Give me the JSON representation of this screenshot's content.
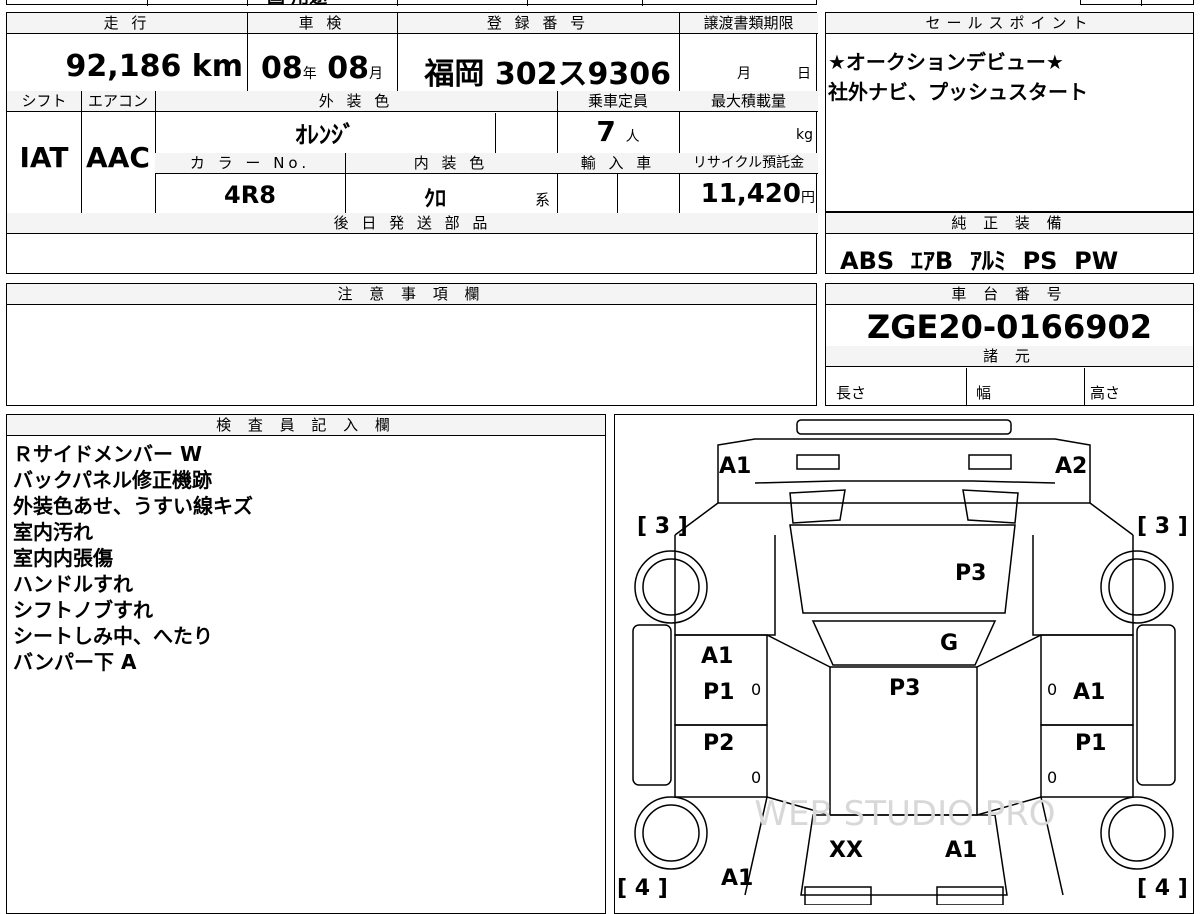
{
  "top_fragments": {
    "left": "国  用途",
    "mid": "♪"
  },
  "mileage": {
    "label": "走 行",
    "value": "92,186",
    "unit": "km"
  },
  "shaken": {
    "label": "車 検",
    "year": "08",
    "year_unit": "年",
    "month": "08",
    "month_unit": "月"
  },
  "plate": {
    "label": "登 録 番 号",
    "area": "福岡",
    "number": "302",
    "kana": "ス",
    "serial": "9306"
  },
  "transfer_deadline": {
    "label": "譲渡書類期限",
    "month_unit": "月",
    "day_unit": "日"
  },
  "shift": {
    "label": "シフト",
    "value": "IAT"
  },
  "aircon": {
    "label": "エアコン",
    "value": "AAC"
  },
  "exterior_color": {
    "label": "外 装 色",
    "value": "ｵﾚﾝｼﾞ"
  },
  "capacity": {
    "label": "乗車定員",
    "value": "7",
    "unit": "人"
  },
  "max_load": {
    "label": "最大積載量",
    "unit": "kg"
  },
  "color_no": {
    "label": "カ ラ ー No.",
    "value": "4R8"
  },
  "interior_color": {
    "label": "内 装 色",
    "value": "ｸﾛ",
    "suffix": "系"
  },
  "import": {
    "label": "輸 入 車"
  },
  "recycle": {
    "label": "リサイクル預託金",
    "value": "11,420",
    "unit": "円"
  },
  "later_parts": {
    "label": "後 日 発 送 部 品"
  },
  "sales_points": {
    "label": "セールスポイント",
    "lines": [
      "★オークションデビュー★",
      "社外ナビ、プッシュスタート"
    ]
  },
  "genuine_equipment": {
    "label": "純 正 装 備",
    "value": "ABS  ｴｱB  ｱﾙﾐ  PS  PW"
  },
  "notes": {
    "label": "注 意 事 項 欄"
  },
  "chassis": {
    "label": "車 台 番 号",
    "value": "ZGE20-0166902"
  },
  "specs": {
    "label": "諸 元",
    "length": "長さ",
    "width": "幅",
    "height": "高さ"
  },
  "inspector": {
    "label": "検 査 員 記 入 欄",
    "lines": [
      "Ｒサイドメンバー W",
      "バックパネル修正機跡",
      "外装色あせ、うすい線キズ",
      "室内汚れ",
      "室内内張傷",
      "ハンドルすれ",
      "シフトノブすれ",
      "シートしみ中、へたり",
      "バンパー下 A"
    ]
  },
  "diagram": {
    "marks": {
      "front_left": "A1",
      "front_right": "A2",
      "hood": "P3",
      "windshield": "G",
      "roof": "P3",
      "left_front_door_a": "A1",
      "left_front_door_p": "P1",
      "left_rear_door": "P2",
      "right_front_door": "A1",
      "right_rear_door": "P1",
      "rear_gate": "XX",
      "rear_right": "A1",
      "rear_bumper_left": "A1",
      "tire_front_left": "3",
      "tire_front_right": "3",
      "tire_rear_left": "4",
      "tire_rear_right": "4",
      "zero": "0"
    },
    "watermark": "WEB STUDIO PRO"
  }
}
